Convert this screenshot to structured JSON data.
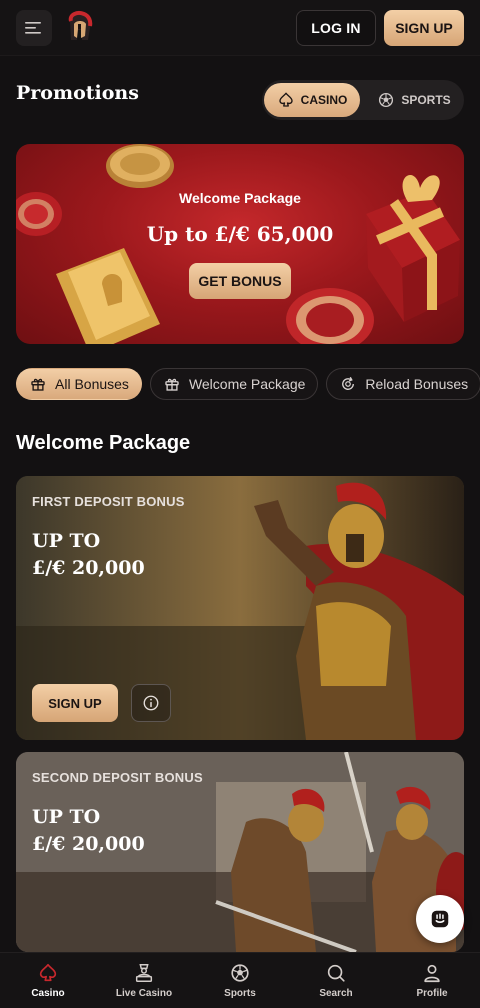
{
  "header": {
    "menu_icon": "menu-icon",
    "logo_icon": "spartan-helmet-logo",
    "login_label": "LOG IN",
    "signup_label": "SIGN UP"
  },
  "promotions": {
    "title": "Promotions",
    "segments": [
      {
        "label": "CASINO",
        "icon": "spade-icon",
        "active": true
      },
      {
        "label": "SPORTS",
        "icon": "soccer-ball-icon",
        "active": false
      }
    ]
  },
  "hero": {
    "title": "Welcome Package",
    "amount": "Up to £/€ 65,000",
    "button_label": "GET BONUS"
  },
  "filters": [
    {
      "label": "All Bonuses",
      "icon": "gift-icon",
      "active": true
    },
    {
      "label": "Welcome Package",
      "icon": "gift-box-icon",
      "active": false
    },
    {
      "label": "Reload Bonuses",
      "icon": "reload-coin-icon",
      "active": false
    }
  ],
  "section": {
    "title": "Welcome Package"
  },
  "cards": [
    {
      "label": "FIRST DEPOSIT BONUS",
      "line1": "UP TO",
      "line2": "£/€ 20,000",
      "signup_label": "SIGN UP"
    },
    {
      "label": "SECOND DEPOSIT BONUS",
      "line1": "UP TO",
      "line2": "£/€ 20,000"
    }
  ],
  "bottom_nav": [
    {
      "label": "Casino",
      "icon": "spade-icon",
      "active": true
    },
    {
      "label": "Live Casino",
      "icon": "dealer-icon",
      "active": false
    },
    {
      "label": "Sports",
      "icon": "soccer-ball-icon",
      "active": false
    },
    {
      "label": "Search",
      "icon": "search-icon",
      "active": false
    },
    {
      "label": "Profile",
      "icon": "profile-icon",
      "active": false
    }
  ],
  "colors": {
    "background": "#131112",
    "accent_gold": "#e5b88c",
    "hero_red": "#9b181c",
    "active_nav": "#c8282d"
  }
}
